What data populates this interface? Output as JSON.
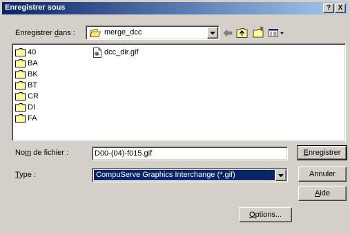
{
  "window": {
    "title": "Enregistrer sous",
    "help_label": "?",
    "close_label": "X"
  },
  "savein": {
    "label_before": "Enregistrer ",
    "label_accel": "d",
    "label_after": "ans :",
    "value": "merge_dcc"
  },
  "toolbar": {
    "icons": [
      "back-arrow-icon",
      "up-folder-icon",
      "new-folder-icon",
      "view-menu-icon"
    ]
  },
  "files": {
    "folders": [
      "40",
      "BA",
      "BK",
      "BT",
      "CR",
      "DI",
      "FA"
    ],
    "gif_file": "dcc_dir.gif"
  },
  "filename": {
    "label_before": "No",
    "label_accel": "m",
    "label_after": " de fichier :",
    "value": "D00-(04)-f015.gif"
  },
  "filetype": {
    "label_accel": "T",
    "label_after": "ype :",
    "value": "CompuServe Graphics Interchange (*.gif)"
  },
  "buttons": {
    "save_accel": "E",
    "save_rest": "nregistrer",
    "cancel": "Annuler",
    "help_accel": "A",
    "help_rest": "ide",
    "options_accel": "O",
    "options_rest": "ptions..."
  },
  "colors": {
    "title_start": "#0a246a",
    "title_end": "#a6caf0",
    "folder": "#ffff99",
    "selection": "#0a246a"
  }
}
